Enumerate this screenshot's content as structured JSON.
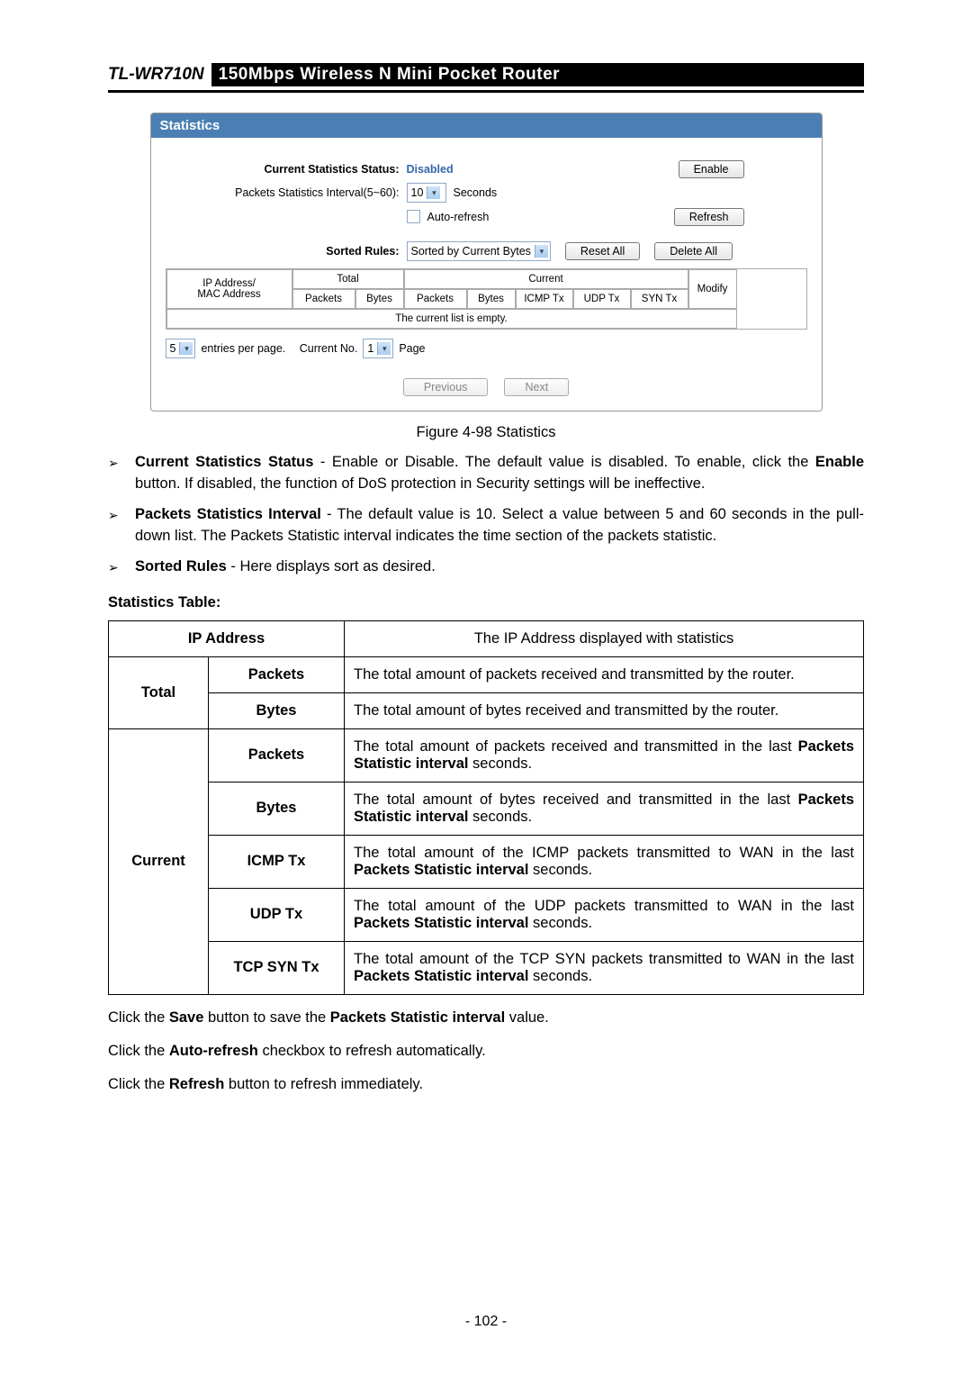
{
  "header": {
    "model": "TL-WR710N",
    "product": "150Mbps Wireless N Mini Pocket Router"
  },
  "ui": {
    "panel_title": "Statistics",
    "status_label": "Current Statistics Status:",
    "status_value": "Disabled",
    "enable_btn": "Enable",
    "interval_label": "Packets Statistics Interval(5~60):",
    "interval_value": "10",
    "seconds": "Seconds",
    "auto_refresh": "Auto-refresh",
    "refresh_btn": "Refresh",
    "sorted_label": "Sorted Rules:",
    "sorted_value": "Sorted by Current Bytes",
    "reset_btn": "Reset All",
    "delete_btn": "Delete All",
    "th_ip": "IP Address/\nMAC Address",
    "th_total": "Total",
    "th_current": "Current",
    "th_packets": "Packets",
    "th_bytes": "Bytes",
    "th_icmp": "ICMP Tx",
    "th_udp": "UDP Tx",
    "th_syn": "SYN Tx",
    "th_modify": "Modify",
    "empty": "The current list is empty.",
    "epp_value": "5",
    "epp_label": "entries per page.",
    "curno_label": "Current No.",
    "curno_value": "1",
    "page_label": "Page",
    "prev": "Previous",
    "next": "Next"
  },
  "caption": "Figure 4-98 Statistics",
  "bullets": [
    {
      "lead": "Current Statistics Status",
      "rest": " - Enable or Disable. The default value is disabled. To enable, click the ",
      "b2": "Enable",
      "rest2": " button. If disabled, the function of DoS protection in Security settings will be ineffective."
    },
    {
      "lead": "Packets Statistics Interval",
      "rest": " - The default value is 10. Select a value between 5 and 60 seconds in the pull-down list. The Packets Statistic interval indicates the time section of the packets statistic."
    },
    {
      "lead": "Sorted Rules",
      "rest": " - Here displays sort as desired."
    }
  ],
  "table_heading": "Statistics Table:",
  "desc": {
    "ip_h": "IP Address",
    "ip_d": "The IP Address displayed with statistics",
    "total": "Total",
    "current": "Current",
    "packets": "Packets",
    "bytes": "Bytes",
    "icmp": "ICMP Tx",
    "udp": "UDP Tx",
    "syn": "TCP SYN Tx",
    "d_tp": "The total amount of packets received and transmitted by the router.",
    "d_tb": "The total amount of bytes received and transmitted by the router.",
    "d_cp_a": "The total amount of packets received and transmitted in the last ",
    "d_cp_b": "Packets Statistic interval",
    "d_cp_c": " seconds.",
    "d_cb_a": "The total amount of bytes received and transmitted in the last ",
    "d_ci_a": "The total amount of the ICMP packets transmitted to WAN in the last ",
    "d_cu_a": "The total amount of the UDP packets transmitted to WAN in the last ",
    "d_cs_a": "The total amount of the TCP SYN packets transmitted to WAN in the last "
  },
  "paras": {
    "p1a": "Click the ",
    "p1b": "Save",
    "p1c": " button to save the ",
    "p1d": "Packets Statistic interval",
    "p1e": " value.",
    "p2a": "Click the ",
    "p2b": "Auto-refresh",
    "p2c": " checkbox to refresh automatically.",
    "p3a": "Click the ",
    "p3b": "Refresh",
    "p3c": " button to refresh immediately."
  },
  "page_number": "- 102 -"
}
